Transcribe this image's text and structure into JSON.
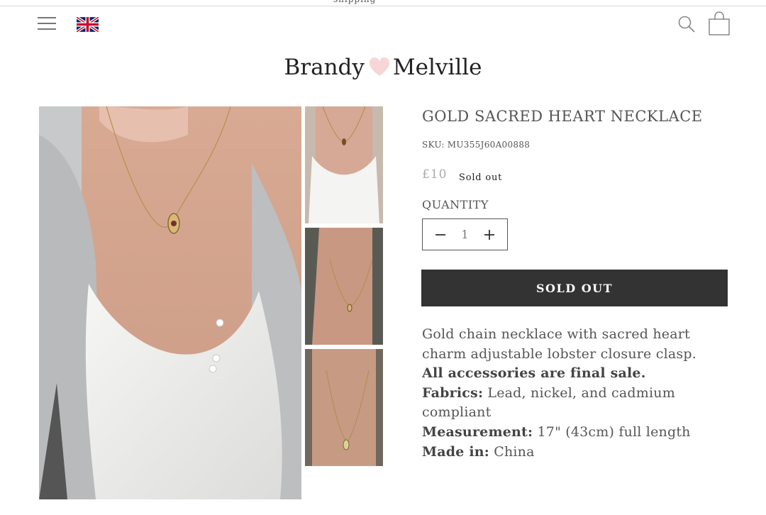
{
  "topbar": {
    "text": "shipping"
  },
  "header": {
    "menu_icon": "hamburger-menu-icon",
    "flag_icon": "uk-flag-icon",
    "search_icon": "search-icon",
    "cart_icon": "shopping-bag-icon"
  },
  "logo": {
    "left": "Brandy",
    "right": "Melville",
    "heart_color": "#f7d6d8"
  },
  "product": {
    "title": "GOLD SACRED HEART NECKLACE",
    "sku": "SKU: MU355J60A00888",
    "price": "£10",
    "badge": "Sold out",
    "quantity_label": "QUANTITY",
    "quantity_value": "1",
    "button_label": "SOLD OUT",
    "description": "Gold chain necklace with sacred heart charm adjustable lobster closure clasp.",
    "final_sale": "All accessories are final sale.",
    "fabrics_label": "Fabrics:",
    "fabrics_value": " Lead, nickel, and cadmium compliant",
    "measurement_label": "Measurement:",
    "measurement_value": " 17\" (43cm) full length",
    "made_in_label": "Made in:",
    "made_in_value": " China"
  },
  "colors": {
    "button_bg": "#333333",
    "text": "#555555",
    "price": "#aaaaaa"
  }
}
